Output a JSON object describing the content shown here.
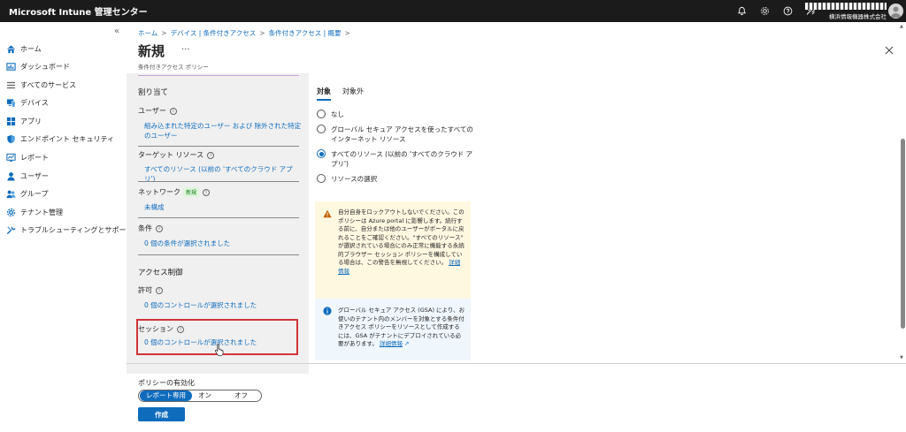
{
  "app": {
    "title": "Microsoft Intune 管理センター",
    "org": "横浜情報機器株式会社"
  },
  "sidebar": {
    "items": [
      {
        "label": "ホーム",
        "icon": "home-icon"
      },
      {
        "label": "ダッシュボード",
        "icon": "dashboard-icon"
      },
      {
        "label": "すべてのサービス",
        "icon": "list-icon"
      },
      {
        "label": "デバイス",
        "icon": "device-icon"
      },
      {
        "label": "アプリ",
        "icon": "apps-grid-icon"
      },
      {
        "label": "エンドポイント セキュリティ",
        "icon": "shield-icon"
      },
      {
        "label": "レポート",
        "icon": "report-icon"
      },
      {
        "label": "ユーザー",
        "icon": "user-icon"
      },
      {
        "label": "グループ",
        "icon": "group-icon"
      },
      {
        "label": "テナント管理",
        "icon": "tenant-icon"
      },
      {
        "label": "トラブルシューティングとサポート",
        "icon": "wrench-icon"
      }
    ]
  },
  "breadcrumb": [
    "ホーム",
    "デバイス | 条件付きアクセス",
    "条件付きアクセス | 概要"
  ],
  "page": {
    "title": "新規",
    "more": "···",
    "subtitle": "条件付きアクセス ポリシー"
  },
  "assignments": {
    "heading": "割り当て",
    "users_label": "ユーザー",
    "users_value": "組み込まれた特定のユーザー および 除外された特定のユーザー",
    "target_label": "ターゲット リソース",
    "target_value": "すべてのリソース (以前の 'すべてのクラウド アプリ')",
    "network_label": "ネットワーク",
    "network_badge": "新規",
    "network_value": "未構成",
    "conditions_label": "条件",
    "conditions_value": "0 個の条件が選択されました"
  },
  "access_controls": {
    "heading": "アクセス制御",
    "grant_label": "許可",
    "grant_value": "0 個のコントロールが選択されました",
    "session_label": "セッション",
    "session_value": "0 個のコントロールが選択されました"
  },
  "tabs": {
    "include": "対象",
    "exclude": "対象外"
  },
  "options": [
    {
      "label": "なし",
      "checked": false
    },
    {
      "label": "グローバル セキュア アクセスを使ったすべてのインターネット リソース",
      "checked": false
    },
    {
      "label": "すべてのリソース (以前の 'すべてのクラウド アプリ')",
      "checked": true
    },
    {
      "label": "リソースの選択",
      "checked": false
    }
  ],
  "warning": {
    "text": "自分自身をロックアウトしないでください。このポリシーは Azure portal に影響します。続行する前に、自分または他のユーザーがポータルに戻れることをご確認ください。\"すべてのリソース\" が選択されている場合にのみ正常に機能する永続的ブラウザー セッション ポリシーを構成している場合は、この警告を無視してください。",
    "link": "詳細情報"
  },
  "info": {
    "text": "グローバル セキュア アクセス (GSA) により、お使いのテナント内のメンバーを対象とする条件付きアクセス ポリシーをリソースとして作成するには、GSA がテナントにデプロイされている必要があります。",
    "link": "詳細情報"
  },
  "policy": {
    "label": "ポリシーの有効化",
    "options": [
      "レポート専用",
      "オン",
      "オフ"
    ],
    "selected": "レポート専用",
    "create": "作成"
  },
  "colors": {
    "accent": "#0f6cbd",
    "highlight": "#d13438",
    "topbar": "#1b1b1b"
  }
}
